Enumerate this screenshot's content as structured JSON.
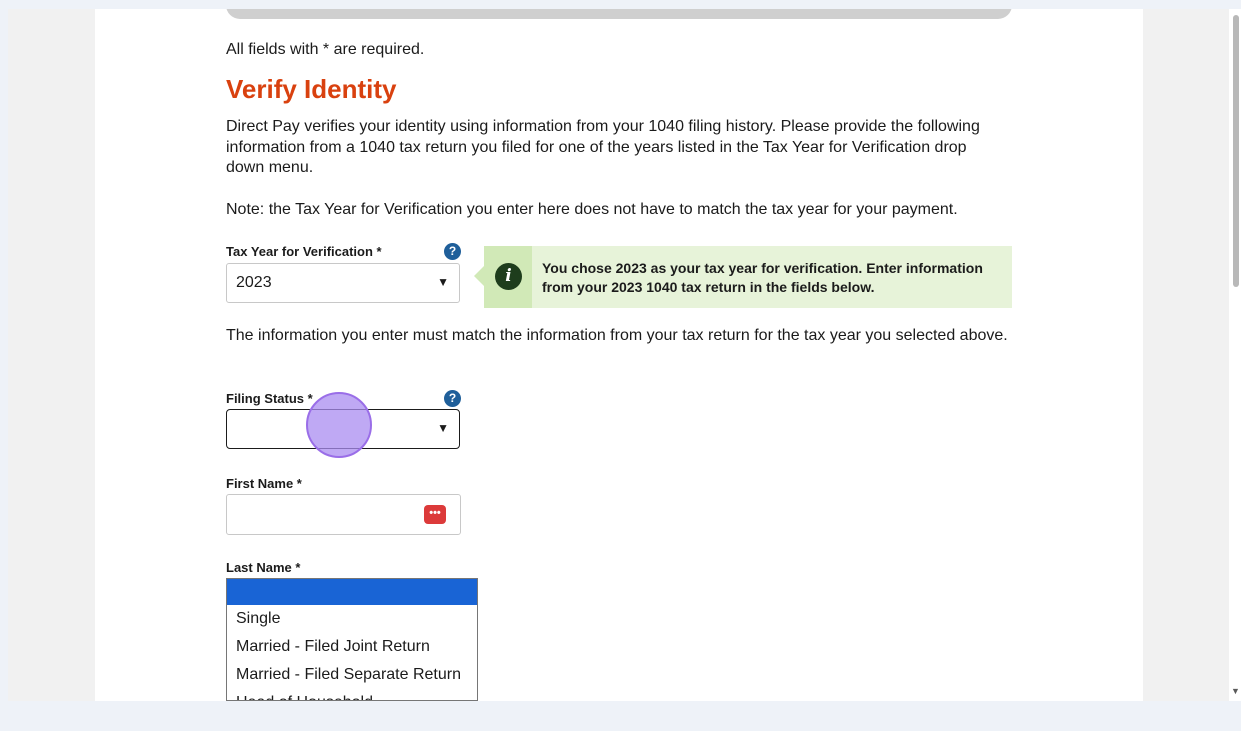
{
  "form": {
    "required_note": "All fields with * are required.",
    "title": "Verify Identity",
    "intro": "Direct Pay verifies your identity using information from your 1040 filing history. Please provide the following information from a 1040 tax return you filed for one of the years listed in the Tax Year for Verification drop down menu.",
    "note": "Note: the Tax Year for Verification you enter here does not have to match the tax year for your payment.",
    "tax_year_label": "Tax Year for Verification *",
    "tax_year_value": "2023",
    "info_message": "You chose 2023 as your tax year for verification. Enter information from your 2023 1040 tax return in the fields below.",
    "match_note": "The information you enter must match the information from your tax return for the tax year you selected above.",
    "filing_status_label": "Filing Status *",
    "filing_status_value": "",
    "first_name_label": "First Name *",
    "first_name_value": "",
    "last_name_label": "Last Name *",
    "help_glyph": "?",
    "info_glyph": "i",
    "caret_glyph": "▼",
    "password_manager_glyph": "•••"
  },
  "filing_status_options": [
    "",
    "Single",
    "Married - Filed Joint Return",
    "Married - Filed Separate Return",
    "Head of Household"
  ],
  "colors": {
    "title": "#d9410f",
    "help_icon": "#1f5f9a",
    "info_background": "#e7f3d9",
    "selected_option": "#1964d5"
  },
  "icons": {
    "help": "question-circle-icon",
    "info": "info-circle-icon",
    "caret": "chevron-down-icon",
    "password_manager": "password-manager-icon"
  }
}
